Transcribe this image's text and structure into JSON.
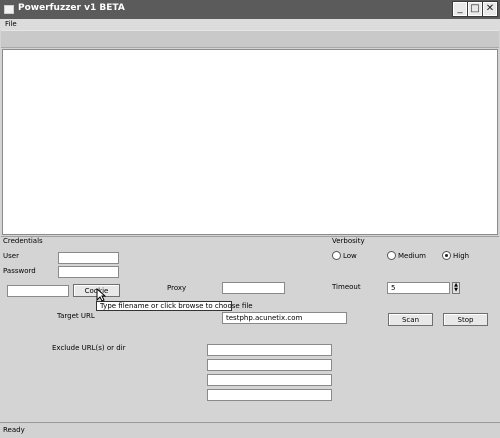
{
  "window": {
    "title": "Powerfuzzer v1 BETA"
  },
  "menu": {
    "file": "File"
  },
  "credentials": {
    "heading": "Credentials",
    "user_label": "User",
    "password_label": "Password",
    "user_value": "",
    "password_value": ""
  },
  "cookie": {
    "value": "",
    "button_label": "Cookie"
  },
  "proxy": {
    "label": "Proxy",
    "value": ""
  },
  "verbosity": {
    "label": "Verbosity",
    "options": [
      "Low",
      "Medium",
      "High"
    ],
    "selected": "High"
  },
  "timeout": {
    "label": "Timeout",
    "value": "5"
  },
  "target": {
    "label": "Target URL",
    "value": "testphp.acunetix.com"
  },
  "actions": {
    "scan": "Scan",
    "stop": "Stop"
  },
  "exclude": {
    "label": "Exclude URL(s) or dir",
    "values": [
      "",
      "",
      "",
      ""
    ]
  },
  "tooltip": {
    "text": "Type filename or click browse to choose file"
  },
  "status": {
    "text": "Ready"
  },
  "icons": {
    "app": "app-window-icon",
    "minimize": "minimize-icon",
    "maximize": "maximize-icon",
    "close": "close-icon",
    "cursor": "mouse-pointer-icon"
  }
}
